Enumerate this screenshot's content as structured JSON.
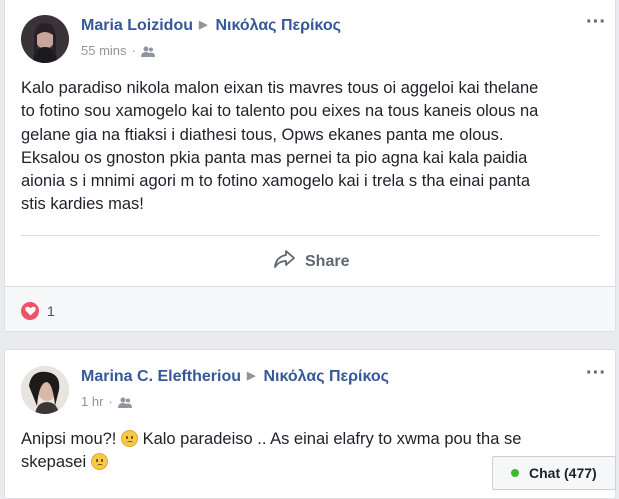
{
  "posts": [
    {
      "author": "Maria Loizidou",
      "target": "Νικόλας Περίκος",
      "time": "55 mins",
      "text": "Kalo paradiso nikola malon eixan tis mavres tous oi aggeloi kai thelane to fotino sou xamogelo kai to talento pou eixes na tous kaneis olous na gelane gia na ftiaksi i diathesi tous, Opws ekanes panta me olous. Eksalou os gnoston pkia panta mas pernei ta pio agna kai kala paidia aionia s i mnimi agori m to fotino xamogelo kai i trela s tha einai panta stis kardies mas!",
      "share_label": "Share",
      "reaction_count": "1"
    },
    {
      "author": "Marina C. Eleftheriou",
      "target": "Νικόλας Περίκος",
      "time": "1 hr",
      "text_part1": "Anipsi mou?!",
      "text_part2": "Kalo paradeiso .. As einai elafry to xwma pou tha se",
      "text_part3": "skepasei"
    }
  ],
  "chat": {
    "label": "Chat (477)"
  },
  "icons": {
    "audience": "friends-icon",
    "menu": "more-options-icon",
    "share": "share-icon",
    "reaction": "love-reaction-icon",
    "emoji": "worried-face-emoji"
  },
  "colors": {
    "link": "#365899",
    "reaction": "#f25268",
    "online": "#42b72a"
  }
}
